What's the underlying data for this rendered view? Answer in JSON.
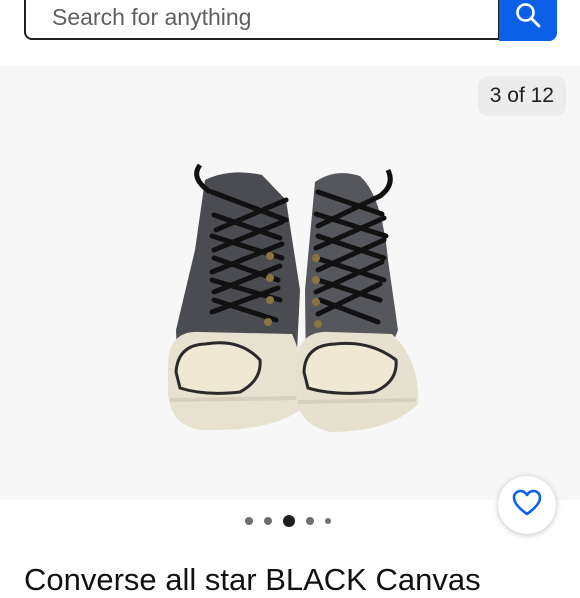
{
  "search": {
    "placeholder": "Search for anything"
  },
  "gallery": {
    "counter": "3 of 12",
    "dots_total": 5,
    "active_dot": 2
  },
  "product": {
    "title": "Converse all star BLACK Canvas"
  },
  "colors": {
    "accent": "#0b60e8",
    "heart": "#0b60e8"
  },
  "icons": {
    "search": "search-icon",
    "favorite": "heart-icon"
  }
}
